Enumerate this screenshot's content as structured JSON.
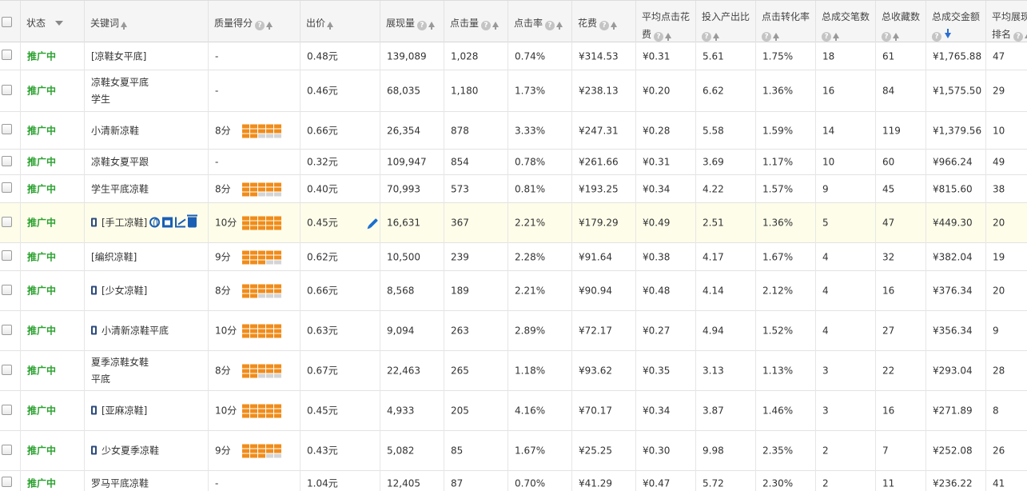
{
  "colors": {
    "status_green": "#2aa12e",
    "bar_orange": "#f08c1b",
    "bar_grey": "#d4d4d4",
    "link_blue": "#1e5b95",
    "highlight_row": "#fefdea"
  },
  "header": {
    "status": "状态",
    "keyword": "关键词",
    "quality": "质量得分",
    "bid": "出价",
    "impressions": "展现量",
    "clicks": "点击量",
    "ctr": "点击率",
    "cost": "花费",
    "avg_cpc": "平均点击花费",
    "roi": "投入产出比",
    "conv_rate": "点击转化率",
    "orders": "总成交笔数",
    "favorites": "总收藏数",
    "gmv": "总成交金额",
    "avg_rank": "平均展现排名"
  },
  "rows": [
    {
      "status": "推广中",
      "keyword": "[凉鞋女平底]",
      "phone": false,
      "actions": false,
      "score": "-",
      "bars": 0,
      "bid": "0.48元",
      "impressions": "139,089",
      "clicks": "1,028",
      "ctr": "0.74%",
      "cost": "¥314.53",
      "avg_cpc": "¥0.31",
      "roi": "5.61",
      "conv_rate": "1.75%",
      "orders": "18",
      "favorites": "61",
      "gmv": "¥1,765.88",
      "avg_rank": "47"
    },
    {
      "status": "推广中",
      "keyword": "凉鞋女夏平底学生",
      "phone": false,
      "actions": false,
      "score": "-",
      "bars": 0,
      "bid": "0.46元",
      "impressions": "68,035",
      "clicks": "1,180",
      "ctr": "1.73%",
      "cost": "¥238.13",
      "avg_cpc": "¥0.20",
      "roi": "6.62",
      "conv_rate": "1.36%",
      "orders": "16",
      "favorites": "84",
      "gmv": "¥1,575.50",
      "avg_rank": "29"
    },
    {
      "status": "推广中",
      "keyword": "小清新凉鞋",
      "phone": false,
      "actions": false,
      "score": "8分",
      "bars": 12,
      "bid": "0.66元",
      "impressions": "26,354",
      "clicks": "878",
      "ctr": "3.33%",
      "cost": "¥247.31",
      "avg_cpc": "¥0.28",
      "roi": "5.58",
      "conv_rate": "1.59%",
      "orders": "14",
      "favorites": "119",
      "gmv": "¥1,379.56",
      "avg_rank": "10"
    },
    {
      "status": "推广中",
      "keyword": "凉鞋女夏平跟",
      "phone": false,
      "actions": false,
      "score": "-",
      "bars": 0,
      "bid": "0.32元",
      "impressions": "109,947",
      "clicks": "854",
      "ctr": "0.78%",
      "cost": "¥261.66",
      "avg_cpc": "¥0.31",
      "roi": "3.69",
      "conv_rate": "1.17%",
      "orders": "10",
      "favorites": "60",
      "gmv": "¥966.24",
      "avg_rank": "49"
    },
    {
      "status": "推广中",
      "keyword": "学生平底凉鞋",
      "phone": false,
      "actions": false,
      "score": "8分",
      "bars": 12,
      "bid": "0.40元",
      "impressions": "70,993",
      "clicks": "573",
      "ctr": "0.81%",
      "cost": "¥193.25",
      "avg_cpc": "¥0.34",
      "roi": "4.22",
      "conv_rate": "1.57%",
      "orders": "9",
      "favorites": "45",
      "gmv": "¥815.60",
      "avg_rank": "38"
    },
    {
      "status": "推广中",
      "keyword": "[手工凉鞋]",
      "phone": true,
      "actions": true,
      "score": "10分",
      "bars": 15,
      "bid": "0.45元",
      "impressions": "16,631",
      "clicks": "367",
      "ctr": "2.21%",
      "cost": "¥179.29",
      "avg_cpc": "¥0.49",
      "roi": "2.51",
      "conv_rate": "1.36%",
      "orders": "5",
      "favorites": "47",
      "gmv": "¥449.30",
      "avg_rank": "20"
    },
    {
      "status": "推广中",
      "keyword": "[编织凉鞋]",
      "phone": false,
      "actions": false,
      "score": "9分",
      "bars": 13,
      "bid": "0.62元",
      "impressions": "10,500",
      "clicks": "239",
      "ctr": "2.28%",
      "cost": "¥91.64",
      "avg_cpc": "¥0.38",
      "roi": "4.17",
      "conv_rate": "1.67%",
      "orders": "4",
      "favorites": "32",
      "gmv": "¥382.04",
      "avg_rank": "19"
    },
    {
      "status": "推广中",
      "keyword": "[少女凉鞋]",
      "phone": true,
      "actions": false,
      "score": "8分",
      "bars": 12,
      "bid": "0.66元",
      "impressions": "8,568",
      "clicks": "189",
      "ctr": "2.21%",
      "cost": "¥90.94",
      "avg_cpc": "¥0.48",
      "roi": "4.14",
      "conv_rate": "2.12%",
      "orders": "4",
      "favorites": "16",
      "gmv": "¥376.34",
      "avg_rank": "20"
    },
    {
      "status": "推广中",
      "keyword": "小清新凉鞋平底",
      "phone": true,
      "actions": false,
      "score": "10分",
      "bars": 15,
      "bid": "0.63元",
      "impressions": "9,094",
      "clicks": "263",
      "ctr": "2.89%",
      "cost": "¥72.17",
      "avg_cpc": "¥0.27",
      "roi": "4.94",
      "conv_rate": "1.52%",
      "orders": "4",
      "favorites": "27",
      "gmv": "¥356.34",
      "avg_rank": "9"
    },
    {
      "status": "推广中",
      "keyword": "夏季凉鞋女鞋平底",
      "phone": false,
      "actions": false,
      "score": "8分",
      "bars": 12,
      "bid": "0.67元",
      "impressions": "22,463",
      "clicks": "265",
      "ctr": "1.18%",
      "cost": "¥93.62",
      "avg_cpc": "¥0.35",
      "roi": "3.13",
      "conv_rate": "1.13%",
      "orders": "3",
      "favorites": "22",
      "gmv": "¥293.04",
      "avg_rank": "28"
    },
    {
      "status": "推广中",
      "keyword": "[亚麻凉鞋]",
      "phone": true,
      "actions": false,
      "score": "10分",
      "bars": 15,
      "bid": "0.45元",
      "impressions": "4,933",
      "clicks": "205",
      "ctr": "4.16%",
      "cost": "¥70.17",
      "avg_cpc": "¥0.34",
      "roi": "3.87",
      "conv_rate": "1.46%",
      "orders": "3",
      "favorites": "16",
      "gmv": "¥271.89",
      "avg_rank": "8"
    },
    {
      "status": "推广中",
      "keyword": "少女夏季凉鞋",
      "phone": true,
      "actions": false,
      "score": "9分",
      "bars": 13,
      "bid": "0.43元",
      "impressions": "5,082",
      "clicks": "85",
      "ctr": "1.67%",
      "cost": "¥25.25",
      "avg_cpc": "¥0.30",
      "roi": "9.98",
      "conv_rate": "2.35%",
      "orders": "2",
      "favorites": "7",
      "gmv": "¥252.08",
      "avg_rank": "26"
    },
    {
      "status": "推广中",
      "keyword": "罗马平底凉鞋",
      "phone": false,
      "actions": false,
      "score": "-",
      "bars": 0,
      "bid": "1.04元",
      "impressions": "12,405",
      "clicks": "87",
      "ctr": "0.70%",
      "cost": "¥41.29",
      "avg_cpc": "¥0.47",
      "roi": "5.72",
      "conv_rate": "2.30%",
      "orders": "2",
      "favorites": "11",
      "gmv": "¥236.22",
      "avg_rank": "41"
    }
  ]
}
